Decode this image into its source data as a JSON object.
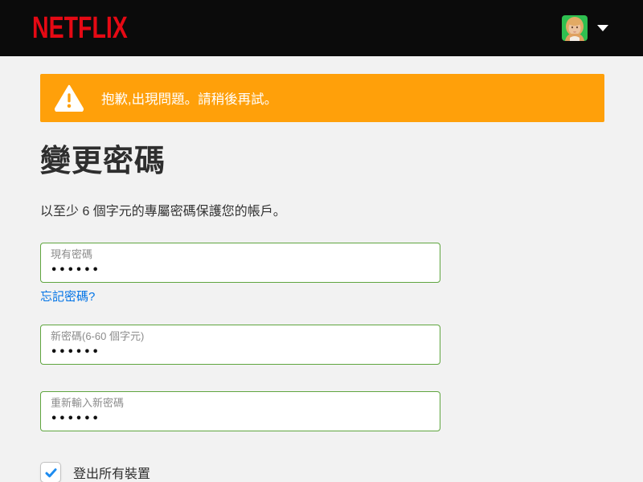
{
  "header": {
    "logo_text": "NETFLIX",
    "avatar_name": "profile-avatar",
    "caret": "dropdown-caret"
  },
  "alert": {
    "message": "抱歉,出現問題。請稍後再試。"
  },
  "page": {
    "title": "變更密碼",
    "subtitle": "以至少 6 個字元的專屬密碼保護您的帳戶。"
  },
  "form": {
    "current_password": {
      "label": "現有密碼",
      "value": "••••••"
    },
    "forgot_link": "忘記密碼?",
    "new_password": {
      "label": "新密碼(6-60 個字元)",
      "value": "••••••"
    },
    "confirm_password": {
      "label": "重新輸入新密碼",
      "value": "••••••"
    },
    "signout_all": {
      "label": "登出所有裝置",
      "checked": true
    }
  },
  "colors": {
    "brand_red": "#e50914",
    "alert_orange": "#ffa00a",
    "input_border_green": "#5fa53f",
    "link_blue": "#0073e6",
    "check_blue": "#1d8cf0",
    "header_black": "#0b0b0b",
    "page_bg": "#f2f2f2"
  }
}
